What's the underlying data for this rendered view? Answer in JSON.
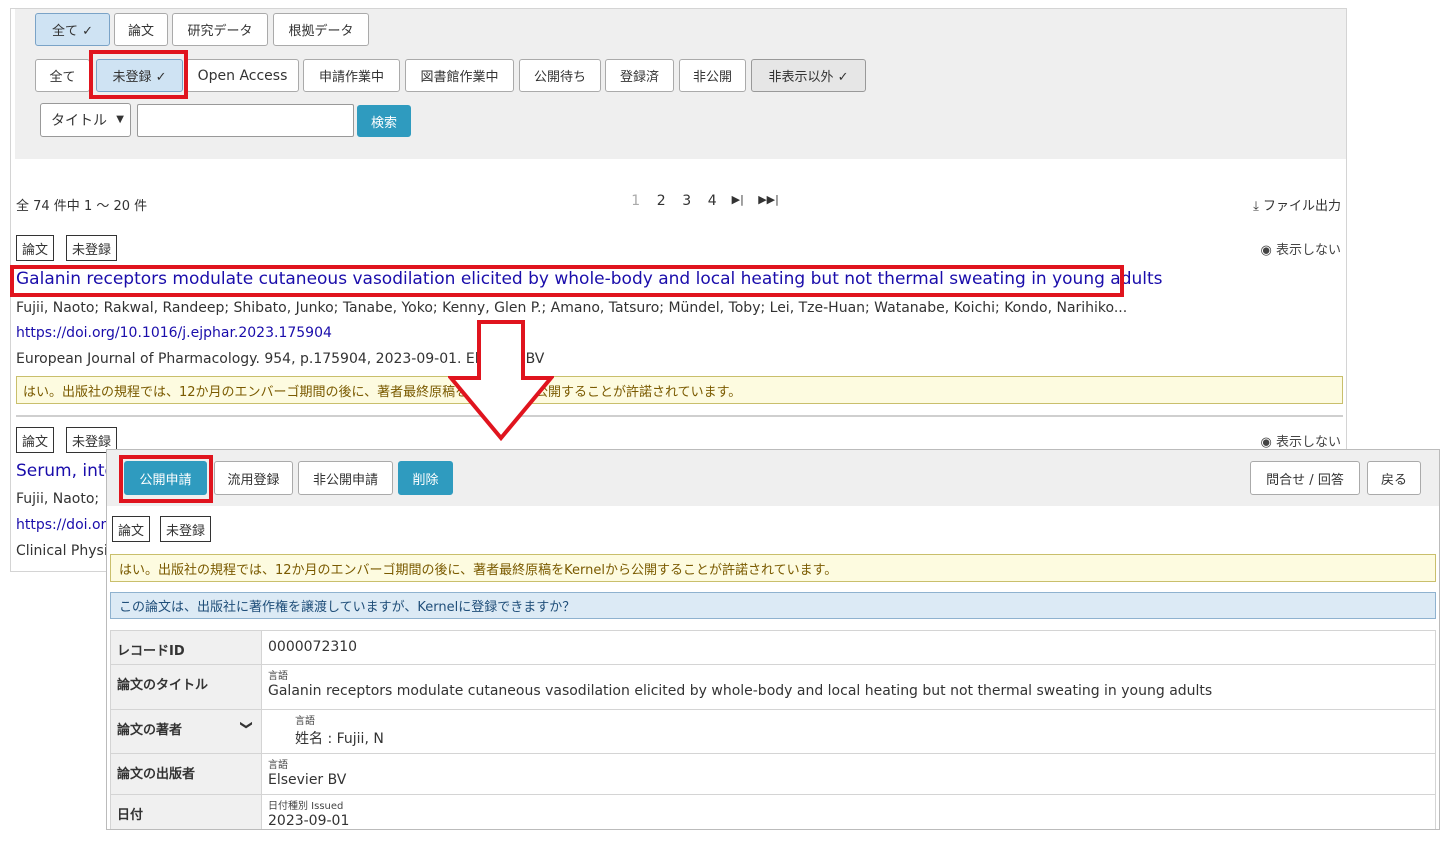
{
  "filters": {
    "type_buttons": [
      "全て ✓",
      "論文",
      "研究データ",
      "根拠データ"
    ],
    "status_buttons": [
      "全て",
      "未登録 ✓",
      "Open Access",
      "申請作業中",
      "図書館作業中",
      "公開待ち",
      "登録済",
      "非公開",
      "非表示以外 ✓"
    ],
    "search_select": "タイトル",
    "search_input": "",
    "search_button": "検索"
  },
  "results": {
    "count": "全 74 件中 1 ～ 20 件",
    "pages": [
      "1",
      "2",
      "3",
      "4",
      "⏭",
      "⏭⏭"
    ],
    "export": "ファイル出力"
  },
  "records": [
    {
      "tags": [
        "論文",
        "未登録"
      ],
      "hide": "表示しない",
      "title": "Galanin receptors modulate cutaneous vasodilation elicited by whole-body and local heating but not thermal sweating in young adults",
      "authors": "Fujii, Naoto; Rakwal, Randeep; Shibato, Junko; Tanabe, Yoko; Kenny, Glen P.; Amano, Tatsuro; Mündel, Toby; Lei, Tze-Huan; Watanabe, Koichi; Kondo, Narihiko...",
      "doi": "https://doi.org/10.1016/j.ejphar.2023.175904",
      "journal": "European Journal of Pharmacology. 954, p.175904, 2023-09-01. Elsevier BV",
      "policy": "はい。出版社の規程では、12か月のエンバーゴ期間の後に、著者最終原稿をKernelから公開することが許諾されています。"
    },
    {
      "tags": [
        "論文",
        "未登録"
      ],
      "hide": "表示しない",
      "title": "Serum, inte",
      "authors": "Fujii, Naoto;",
      "doi": "https://doi.or",
      "journal": "Clinical Physic"
    }
  ],
  "detail": {
    "actions": [
      "公開申請",
      "流用登録",
      "非公開申請",
      "削除"
    ],
    "right_actions": [
      "問合せ / 回答",
      "戻る"
    ],
    "tags": [
      "論文",
      "未登録"
    ],
    "policy": "はい。出版社の規程では、12か月のエンバーゴ期間の後に、著者最終原稿をKernelから公開することが許諾されています。",
    "question": "この論文は、出版社に著作権を譲渡していますが、Kernelに登録できますか？",
    "rows": [
      {
        "key": "レコードID",
        "value": "0000072310"
      },
      {
        "key": "論文のタイトル",
        "sub": "言語",
        "value": "Galanin receptors modulate cutaneous vasodilation elicited by whole-body and local heating but not thermal sweating in young adults"
      },
      {
        "key": "論文の著者",
        "sub": "言語",
        "value": "姓名 : Fujii, N"
      },
      {
        "key": "論文の出版者",
        "sub": "言語",
        "value": "Elsevier BV"
      },
      {
        "key": "日付",
        "sub": "日付種別   Issued",
        "value": "2023-09-01"
      }
    ]
  },
  "colors": {
    "accent_teal": "#2f9bbf",
    "highlight_red": "#e0141e",
    "link": "#1a0dab"
  }
}
